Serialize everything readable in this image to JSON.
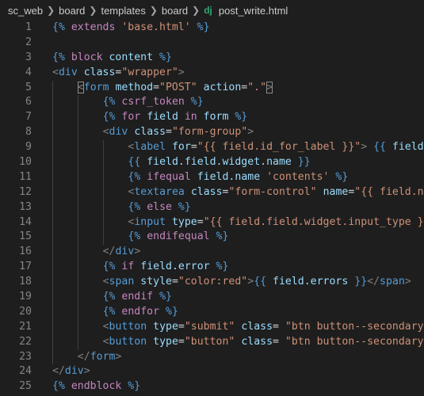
{
  "breadcrumb": {
    "items": [
      "sc_web",
      "board",
      "templates",
      "board"
    ],
    "file_icon": "dj",
    "file_name": "post_write.html"
  },
  "lines": [
    {
      "n": "1",
      "indent": 0,
      "tokens": [
        [
          "dj",
          "{% "
        ],
        [
          "kw",
          "extends"
        ],
        [
          "str",
          " 'base.html'"
        ],
        [
          "dj",
          " %}"
        ]
      ]
    },
    {
      "n": "2",
      "indent": 0,
      "tokens": []
    },
    {
      "n": "3",
      "indent": 0,
      "tokens": [
        [
          "dj",
          "{% "
        ],
        [
          "kw",
          "block"
        ],
        [
          "var",
          " content"
        ],
        [
          "dj",
          " %}"
        ]
      ]
    },
    {
      "n": "4",
      "indent": 0,
      "tokens": [
        [
          "ang",
          "<"
        ],
        [
          "tag",
          "div"
        ],
        [
          "attr",
          " class"
        ],
        [
          "txt",
          "="
        ],
        [
          "str",
          "\"wrapper\""
        ],
        [
          "ang",
          ">"
        ]
      ]
    },
    {
      "n": "5",
      "indent": 1,
      "tokens": [
        [
          "ang",
          "<"
        ],
        [
          "tag",
          "form"
        ],
        [
          "attr",
          " method"
        ],
        [
          "txt",
          "="
        ],
        [
          "str",
          "\"POST\""
        ],
        [
          "attr",
          " action"
        ],
        [
          "txt",
          "="
        ],
        [
          "str",
          "\".\""
        ],
        [
          "ang",
          ">"
        ]
      ]
    },
    {
      "n": "6",
      "indent": 2,
      "tokens": [
        [
          "dj",
          "{% "
        ],
        [
          "kw",
          "csrf_token"
        ],
        [
          "dj",
          " %}"
        ]
      ]
    },
    {
      "n": "7",
      "indent": 2,
      "tokens": [
        [
          "dj",
          "{% "
        ],
        [
          "kw",
          "for"
        ],
        [
          "var",
          " field"
        ],
        [
          "kw",
          " in"
        ],
        [
          "var",
          " form"
        ],
        [
          "dj",
          " %}"
        ]
      ]
    },
    {
      "n": "8",
      "indent": 2,
      "tokens": [
        [
          "ang",
          "<"
        ],
        [
          "tag",
          "div"
        ],
        [
          "attr",
          " class"
        ],
        [
          "txt",
          "="
        ],
        [
          "str",
          "\"form-group\""
        ],
        [
          "ang",
          ">"
        ]
      ]
    },
    {
      "n": "9",
      "indent": 3,
      "tokens": [
        [
          "ang",
          "<"
        ],
        [
          "tag",
          "label"
        ],
        [
          "attr",
          " for"
        ],
        [
          "txt",
          "="
        ],
        [
          "str",
          "\"{{ field.id_for_label }}\""
        ],
        [
          "ang",
          ">"
        ],
        [
          "dj",
          " {{ "
        ],
        [
          "var",
          "field.l"
        ]
      ]
    },
    {
      "n": "10",
      "indent": 3,
      "tokens": [
        [
          "dj",
          "{{ "
        ],
        [
          "var",
          "field.field.widget.name"
        ],
        [
          "dj",
          " }}"
        ]
      ]
    },
    {
      "n": "11",
      "indent": 3,
      "tokens": [
        [
          "dj",
          "{% "
        ],
        [
          "kw",
          "ifequal"
        ],
        [
          "var",
          " field.name"
        ],
        [
          "str",
          " 'contents'"
        ],
        [
          "dj",
          " %}"
        ]
      ]
    },
    {
      "n": "12",
      "indent": 3,
      "tokens": [
        [
          "ang",
          "<"
        ],
        [
          "tag",
          "textarea"
        ],
        [
          "attr",
          " class"
        ],
        [
          "txt",
          "="
        ],
        [
          "str",
          "\"form-control\""
        ],
        [
          "attr",
          " name"
        ],
        [
          "txt",
          "="
        ],
        [
          "str",
          "\"{{ field.nam"
        ]
      ]
    },
    {
      "n": "13",
      "indent": 3,
      "tokens": [
        [
          "dj",
          "{% "
        ],
        [
          "kw",
          "else"
        ],
        [
          "dj",
          " %}"
        ]
      ]
    },
    {
      "n": "14",
      "indent": 3,
      "tokens": [
        [
          "ang",
          "<"
        ],
        [
          "tag",
          "input"
        ],
        [
          "attr",
          " type"
        ],
        [
          "txt",
          "="
        ],
        [
          "str",
          "\"{{ field.field.widget.input_type }}\""
        ]
      ]
    },
    {
      "n": "15",
      "indent": 3,
      "tokens": [
        [
          "dj",
          "{% "
        ],
        [
          "kw",
          "endifequal"
        ],
        [
          "dj",
          " %}"
        ]
      ]
    },
    {
      "n": "16",
      "indent": 2,
      "tokens": [
        [
          "ang",
          "</"
        ],
        [
          "tag",
          "div"
        ],
        [
          "ang",
          ">"
        ]
      ]
    },
    {
      "n": "17",
      "indent": 2,
      "tokens": [
        [
          "dj",
          "{% "
        ],
        [
          "kw",
          "if"
        ],
        [
          "var",
          " field.error"
        ],
        [
          "dj",
          " %}"
        ]
      ]
    },
    {
      "n": "18",
      "indent": 2,
      "tokens": [
        [
          "ang",
          "<"
        ],
        [
          "tag",
          "span"
        ],
        [
          "attr",
          " style"
        ],
        [
          "txt",
          "="
        ],
        [
          "str",
          "\"color:red\""
        ],
        [
          "ang",
          ">"
        ],
        [
          "dj",
          "{{ "
        ],
        [
          "var",
          "field.errors"
        ],
        [
          "dj",
          " }}"
        ],
        [
          "ang",
          "</"
        ],
        [
          "tag",
          "span"
        ],
        [
          "ang",
          ">"
        ]
      ]
    },
    {
      "n": "19",
      "indent": 2,
      "tokens": [
        [
          "dj",
          "{% "
        ],
        [
          "kw",
          "endif"
        ],
        [
          "dj",
          " %}"
        ]
      ]
    },
    {
      "n": "20",
      "indent": 2,
      "tokens": [
        [
          "dj",
          "{% "
        ],
        [
          "kw",
          "endfor"
        ],
        [
          "dj",
          " %}"
        ]
      ]
    },
    {
      "n": "21",
      "indent": 2,
      "tokens": [
        [
          "ang",
          "<"
        ],
        [
          "tag",
          "button"
        ],
        [
          "attr",
          " type"
        ],
        [
          "txt",
          "="
        ],
        [
          "str",
          "\"submit\""
        ],
        [
          "attr",
          " class"
        ],
        [
          "txt",
          "= "
        ],
        [
          "str",
          "\"btn button--secondary\""
        ],
        [
          "ang",
          ">"
        ]
      ]
    },
    {
      "n": "22",
      "indent": 2,
      "tokens": [
        [
          "ang",
          "<"
        ],
        [
          "tag",
          "button"
        ],
        [
          "attr",
          " type"
        ],
        [
          "txt",
          "="
        ],
        [
          "str",
          "\"button\""
        ],
        [
          "attr",
          " class"
        ],
        [
          "txt",
          "= "
        ],
        [
          "str",
          "\"btn button--secondary\""
        ]
      ]
    },
    {
      "n": "23",
      "indent": 1,
      "tokens": [
        [
          "ang",
          "</"
        ],
        [
          "tag",
          "form"
        ],
        [
          "ang",
          ">"
        ]
      ]
    },
    {
      "n": "24",
      "indent": 0,
      "tokens": [
        [
          "ang",
          "</"
        ],
        [
          "tag",
          "div"
        ],
        [
          "ang",
          ">"
        ]
      ]
    },
    {
      "n": "25",
      "indent": 0,
      "tokens": [
        [
          "dj",
          "{% "
        ],
        [
          "kw",
          "endblock"
        ],
        [
          "dj",
          " %}"
        ]
      ]
    }
  ],
  "colors": {
    "background": "#1e1e1e",
    "line_number": "#858585",
    "tag": "#569cd6",
    "attribute": "#9cdcfe",
    "string": "#ce9178",
    "keyword": "#c586c0",
    "django_delimiter": "#569cd6",
    "indent_guide": "#404040"
  }
}
